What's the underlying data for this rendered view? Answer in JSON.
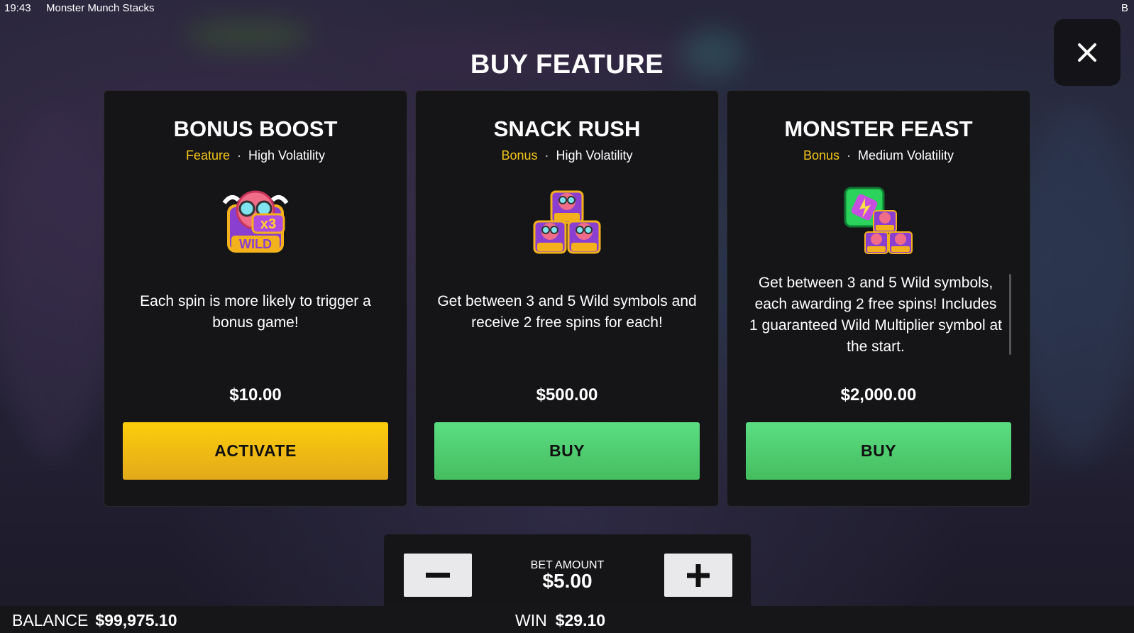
{
  "status": {
    "time": "19:43",
    "game_title": "Monster Munch Stacks",
    "corner": "B"
  },
  "close_icon": "close-icon",
  "title": "BUY FEATURE",
  "cards": [
    {
      "name": "BONUS BOOST",
      "kind": "Feature",
      "separator": "·",
      "volatility": "High Volatility",
      "image": "x3-wild-monster-icon",
      "description": "Each spin is more likely to trigger a bonus game!",
      "price": "$10.00",
      "button": "ACTIVATE",
      "button_color": "#fccd0c"
    },
    {
      "name": "SNACK RUSH",
      "kind": "Bonus",
      "separator": "·",
      "volatility": "High Volatility",
      "image": "three-wild-monsters-icon",
      "description": "Get between 3 and 5 Wild symbols and receive 2 free spins for each!",
      "price": "$500.00",
      "button": "BUY",
      "button_color": "#5bde82"
    },
    {
      "name": "MONSTER FEAST",
      "kind": "Bonus",
      "separator": "·",
      "volatility": "Medium Volatility",
      "image": "battery-and-wild-monsters-icon",
      "description": "Get between 3 and 5 Wild symbols, each awarding 2 free spins! Includes 1 guaranteed Wild Multiplier symbol at the start.",
      "price": "$2,000.00",
      "button": "BUY",
      "button_color": "#5bde82"
    }
  ],
  "bet": {
    "label": "BET AMOUNT",
    "value": "$5.00",
    "minus_icon": "minus-icon",
    "plus_icon": "plus-icon"
  },
  "footer": {
    "balance_label": "BALANCE",
    "balance_value": "$99,975.10",
    "win_label": "WIN",
    "win_value": "$29.10"
  },
  "colors": {
    "accent_yellow": "#f5c518",
    "buy_green": "#5bde82",
    "panel": "#151518"
  }
}
